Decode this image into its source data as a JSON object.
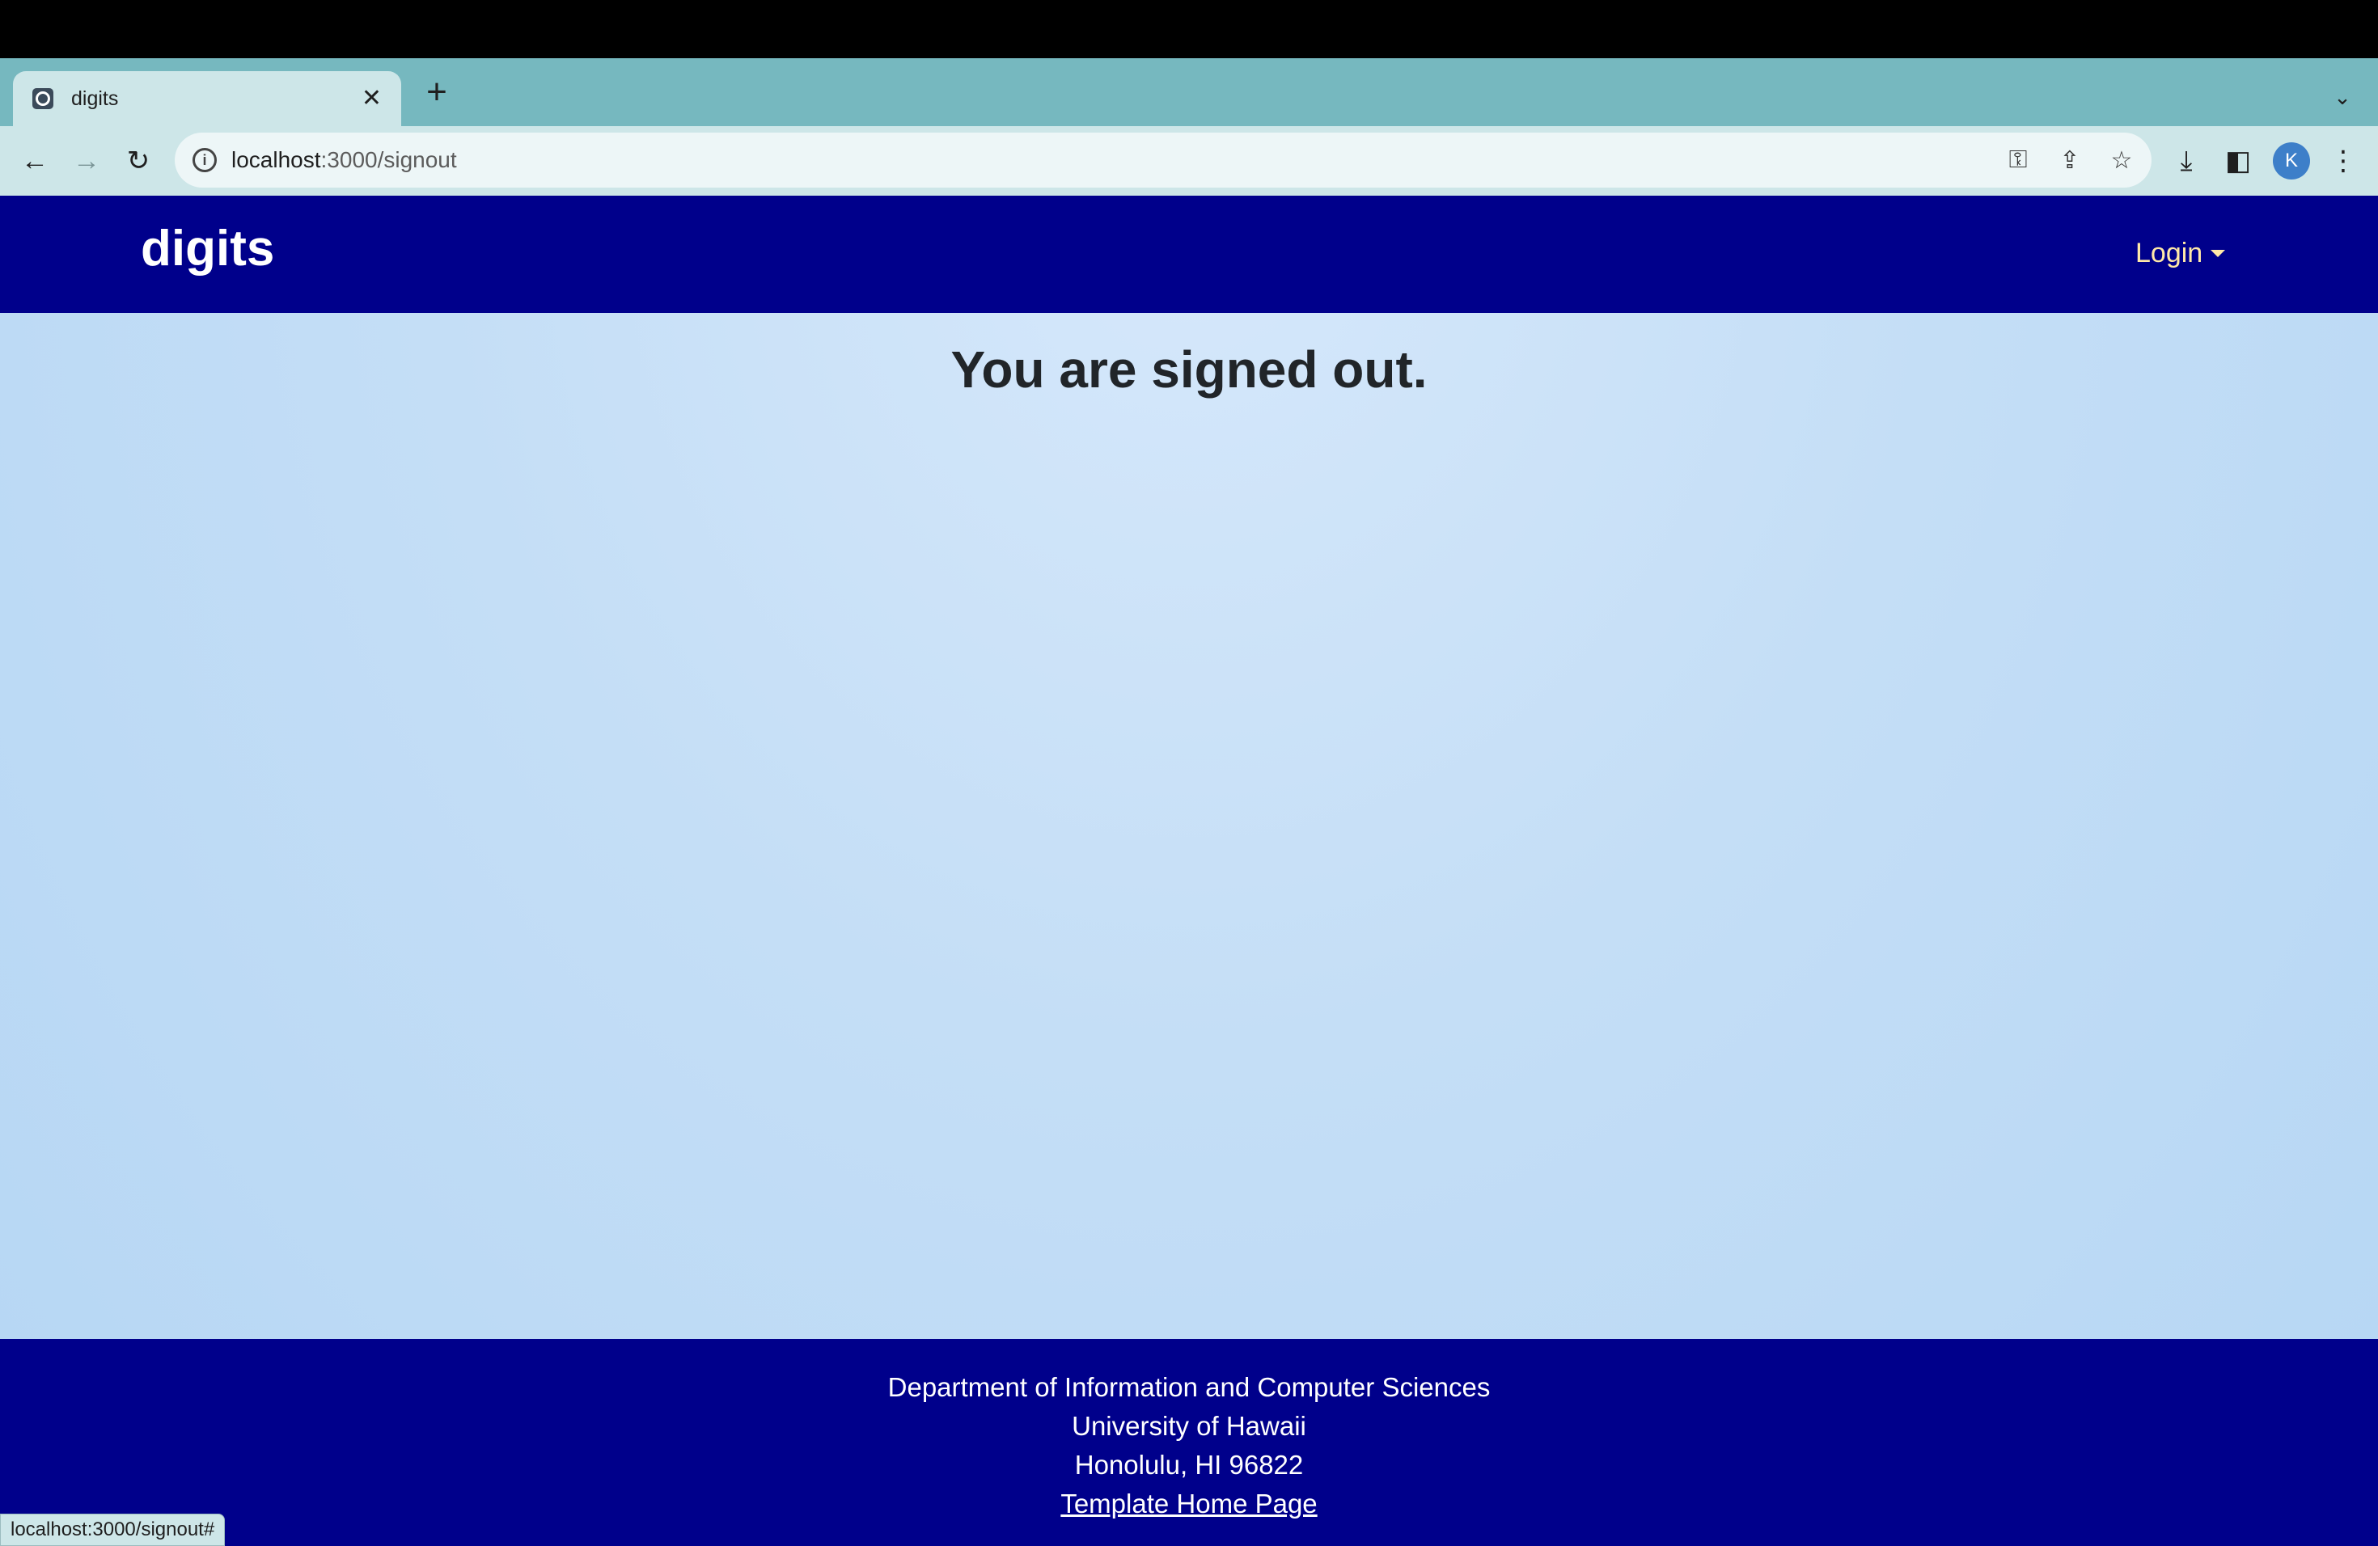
{
  "browser": {
    "tab": {
      "title": "digits",
      "close_glyph": "✕",
      "favicon": "app-favicon-icon"
    },
    "new_tab_glyph": "+",
    "tab_menu_glyph": "⌄",
    "toolbar": {
      "back_glyph": "←",
      "forward_glyph": "→",
      "reload_glyph": "↻",
      "info_glyph": "i",
      "url_host": "localhost",
      "url_path": ":3000/signout",
      "key_glyph": "⚿",
      "share_glyph": "⇪",
      "star_glyph": "☆",
      "download_glyph": "⤓",
      "sidepanel_glyph": "◧",
      "avatar_letter": "K",
      "menu_glyph": "⋮"
    },
    "status_url": "localhost:3000/signout#"
  },
  "app": {
    "brand": "digits",
    "login_label": "Login",
    "headline": "You are signed out.",
    "footer": {
      "line1": "Department of Information and Computer Sciences",
      "line2": "University of Hawaii",
      "line3": "Honolulu, HI 96822",
      "link": "Template Home Page"
    }
  },
  "colors": {
    "navbar": "#00008b",
    "login_text": "#ffe9a8",
    "browser_chrome": "#76b8bf",
    "page_background": "#c4def6"
  }
}
